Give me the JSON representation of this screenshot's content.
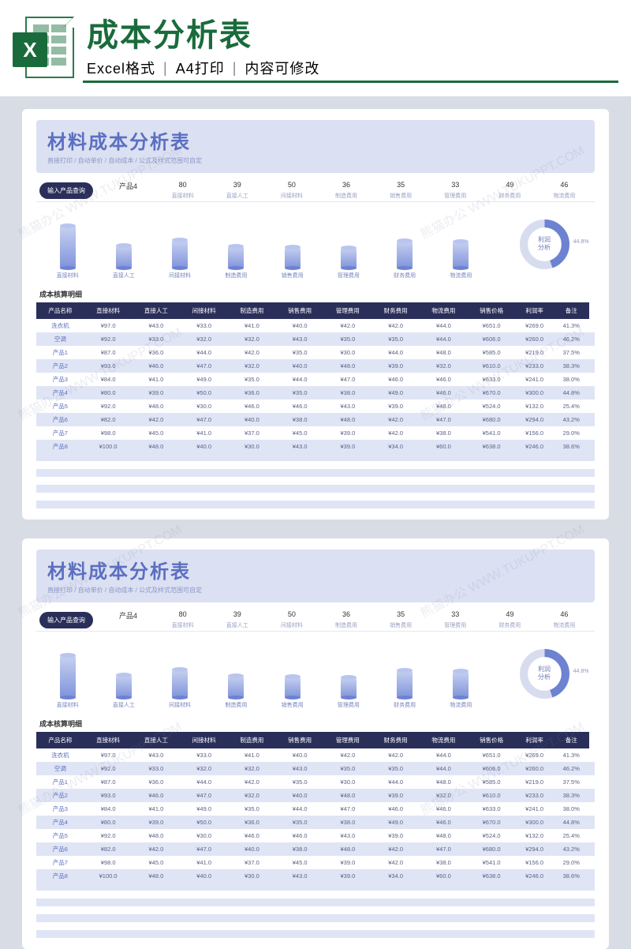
{
  "banner": {
    "title": "成本分析表",
    "subtitle_parts": [
      "Excel格式",
      "A4打印",
      "内容可修改"
    ]
  },
  "doc": {
    "title": "材料成本分析表",
    "subtitle": "直接打印 / 自动单价 / 自动成本 / 公式及样式范围可自定"
  },
  "query": {
    "pill": "输入产品查询",
    "columns": [
      {
        "value": "产品4",
        "label": ""
      },
      {
        "value": "80",
        "label": "直接材料"
      },
      {
        "value": "39",
        "label": "直接人工"
      },
      {
        "value": "50",
        "label": "间接材料"
      },
      {
        "value": "36",
        "label": "制造费用"
      },
      {
        "value": "35",
        "label": "销售费用"
      },
      {
        "value": "33",
        "label": "管理费用"
      },
      {
        "value": "49",
        "label": "财务费用"
      },
      {
        "value": "46",
        "label": "物流费用"
      }
    ]
  },
  "chart_data": {
    "type": "bar",
    "categories": [
      "直接材料",
      "直接人工",
      "间接材料",
      "制造费用",
      "销售费用",
      "管理费用",
      "财务费用",
      "物流费用"
    ],
    "values": [
      80,
      39,
      50,
      36,
      35,
      33,
      49,
      46
    ],
    "ylim": [
      0,
      100
    ],
    "title": "",
    "donut": {
      "label": "利润分析",
      "percent": "44.8%",
      "value": 44.8
    }
  },
  "detail_title": "成本核算明细",
  "table": {
    "headers": [
      "产品名称",
      "直接材料",
      "直接人工",
      "间接材料",
      "制造费用",
      "销售费用",
      "管理费用",
      "财务费用",
      "物流费用",
      "销售价格",
      "利润率",
      "备注"
    ],
    "rows": [
      [
        "洗衣机",
        "¥97.0",
        "¥43.0",
        "¥33.0",
        "¥41.0",
        "¥40.0",
        "¥42.0",
        "¥42.0",
        "¥44.0",
        "¥651.0",
        "¥269.0",
        "41.3%"
      ],
      [
        "空调",
        "¥92.0",
        "¥33.0",
        "¥32.0",
        "¥32.0",
        "¥43.0",
        "¥35.0",
        "¥35.0",
        "¥44.0",
        "¥606.0",
        "¥260.0",
        "46.2%"
      ],
      [
        "产品1",
        "¥87.0",
        "¥36.0",
        "¥44.0",
        "¥42.0",
        "¥35.0",
        "¥30.0",
        "¥44.0",
        "¥48.0",
        "¥585.0",
        "¥219.0",
        "37.5%"
      ],
      [
        "产品2",
        "¥93.0",
        "¥46.0",
        "¥47.0",
        "¥32.0",
        "¥40.0",
        "¥48.0",
        "¥39.0",
        "¥32.0",
        "¥610.0",
        "¥233.0",
        "38.3%"
      ],
      [
        "产品3",
        "¥84.0",
        "¥41.0",
        "¥49.0",
        "¥35.0",
        "¥44.0",
        "¥47.0",
        "¥46.0",
        "¥46.0",
        "¥633.0",
        "¥241.0",
        "38.0%"
      ],
      [
        "产品4",
        "¥80.0",
        "¥39.0",
        "¥50.0",
        "¥36.0",
        "¥35.0",
        "¥38.0",
        "¥49.0",
        "¥46.0",
        "¥670.0",
        "¥300.0",
        "44.8%"
      ],
      [
        "产品5",
        "¥92.0",
        "¥48.0",
        "¥30.0",
        "¥46.0",
        "¥46.0",
        "¥43.0",
        "¥39.0",
        "¥48.0",
        "¥524.0",
        "¥132.0",
        "25.4%"
      ],
      [
        "产品6",
        "¥82.0",
        "¥42.0",
        "¥47.0",
        "¥40.0",
        "¥38.0",
        "¥48.0",
        "¥42.0",
        "¥47.0",
        "¥680.0",
        "¥294.0",
        "43.2%"
      ],
      [
        "产品7",
        "¥98.0",
        "¥45.0",
        "¥41.0",
        "¥37.0",
        "¥45.0",
        "¥39.0",
        "¥42.0",
        "¥38.0",
        "¥541.0",
        "¥156.0",
        "29.0%"
      ],
      [
        "产品8",
        "¥100.0",
        "¥48.0",
        "¥40.0",
        "¥30.0",
        "¥43.0",
        "¥39.0",
        "¥34.0",
        "¥60.0",
        "¥638.0",
        "¥246.0",
        "38.6%"
      ]
    ]
  },
  "watermark": "熊猫办公 WWW.TUKUPPT.COM"
}
